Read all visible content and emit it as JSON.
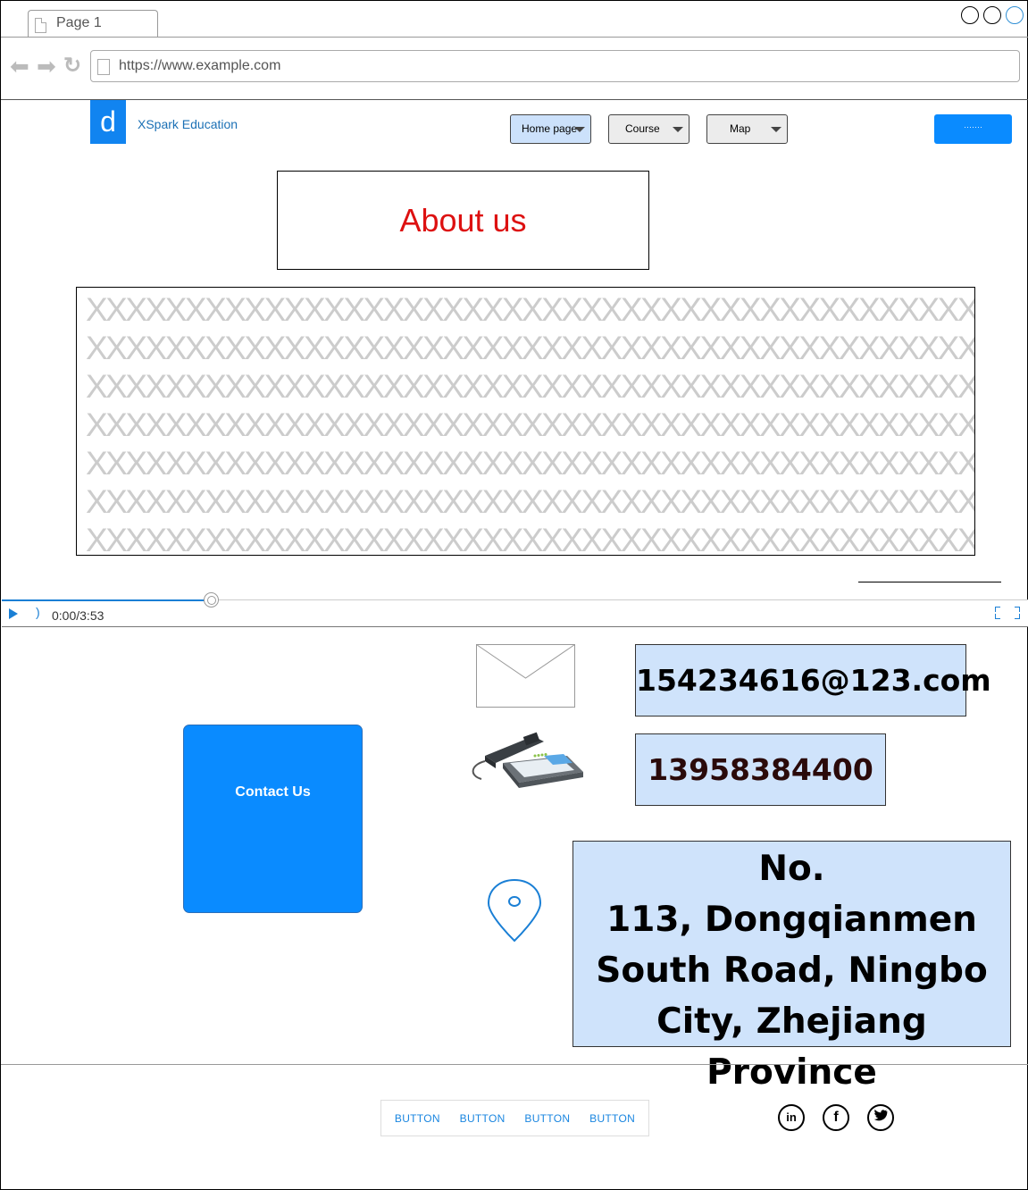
{
  "browser": {
    "tab_label": "Page 1",
    "url": "https://www.example.com"
  },
  "header": {
    "logo_letter": "d",
    "brand": "XSpark Education",
    "nav": [
      {
        "label": "Home page"
      },
      {
        "label": "Course"
      },
      {
        "label": "Map"
      }
    ],
    "action_button_label": "·······"
  },
  "about": {
    "title": "About us",
    "placeholder_lines": [
      "XXXXXXXXXXXXXXXXXXXXXXXXXXXXXXXXXXXXXXXXXXXXXXXXX",
      "XXXXXXXXXXXXXXXXXXXXXXXXXXXXXXXXXXXXXXXXXXXXXXXXX",
      "XXXXXXXXXXXXXXXXXXXXXXXXXXXXXXXXXXXXXXXXXXXXXXXXX",
      "XXXXXXXXXXXXXXXXXXXXXXXXXXXXXXXXXXXXXXXXXXXXXXXXX",
      "XXXXXXXXXXXXXXXXXXXXXXXXXXXXXXXXXXXXXXXXXXXXXXXXX",
      "XXXXXXXXXXXXXXXXXXXXXXXXXXXXXXXXXXXXXXXXXXXXXXXXX",
      "XXXXXXXXXXXXXXXXXXXXXXXXXXXXXXXXXXXXXXXXXXXXXXXXX"
    ]
  },
  "video": {
    "time": "0:00/3:53"
  },
  "contact": {
    "button_label": "Contact Us",
    "email": "154234616@123.com",
    "phone": "13958384400",
    "address_lines": [
      "No.",
      "113, Dongqianmen",
      "South Road, Ningbo",
      "City, Zhejiang Province"
    ]
  },
  "footer": {
    "buttons": [
      {
        "label": "BUTTON"
      },
      {
        "label": "BUTTON"
      },
      {
        "label": "BUTTON"
      },
      {
        "label": "BUTTON"
      }
    ],
    "social": [
      {
        "icon": "linkedin-icon",
        "glyph": "in"
      },
      {
        "icon": "facebook-icon",
        "glyph": "f"
      },
      {
        "icon": "twitter-icon",
        "glyph": "t"
      }
    ]
  },
  "colors": {
    "accent": "#0a8bff",
    "title_red": "#dd1111",
    "info_bg": "#cfe3fb"
  }
}
